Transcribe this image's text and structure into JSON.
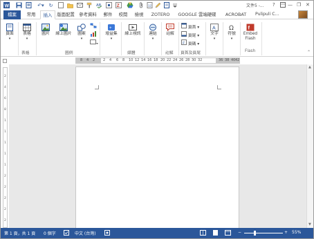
{
  "title_bar": {
    "title": "文件5 -...",
    "help": "?",
    "minimize": "—",
    "restore": "❐",
    "close": "✕"
  },
  "tabs": {
    "file": "檔案",
    "items": [
      "常用",
      "插入",
      "版面配置",
      "參考資料",
      "郵件",
      "校閱",
      "檢視",
      "ZOTERO",
      "GOOGLE 雲端硬碟",
      "ACROBAT"
    ],
    "active": "插入",
    "user": "Pulipuli C..."
  },
  "ribbon": {
    "page": "頁面",
    "table": "表格",
    "picture": "圖片",
    "online_picture": "線上圖片",
    "shapes": "圖案",
    "addins": "增益集",
    "online_video": "線上視訊",
    "links": "連結",
    "comment": "註解",
    "header": "頁首",
    "footer": "頁尾",
    "page_number": "頁碼",
    "text": "文字",
    "symbols": "符號",
    "embed_flash_1": "Embed",
    "embed_flash_2": "Flash",
    "groups": {
      "tables": "表格",
      "illustrations": "圖例",
      "media": "媒體",
      "comments": "註解",
      "header_footer": "頁首及頁尾",
      "flash": "Flash"
    }
  },
  "ruler": {
    "labels": [
      "8",
      "4",
      "2",
      "2",
      "4",
      "6",
      "8",
      "10",
      "12",
      "14",
      "16",
      "18",
      "20",
      "22",
      "24",
      "26",
      "28",
      "30",
      "32",
      "36",
      "38",
      "40",
      "42"
    ],
    "vlabels": [
      "2",
      "4",
      "6",
      "8",
      "10",
      "12",
      "14",
      "16",
      "18",
      "20",
      "22",
      "24",
      "26",
      "28"
    ]
  },
  "status": {
    "page": "第 1 頁，共 1 頁",
    "words": "0 個字",
    "language": "中文 (台灣)",
    "zoom": "55%"
  },
  "colors": {
    "accent": "#2b579a"
  }
}
